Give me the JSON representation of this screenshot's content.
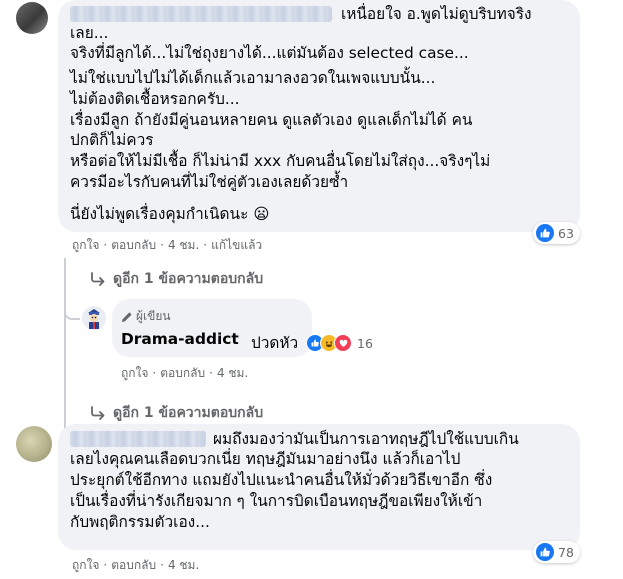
{
  "comments": [
    {
      "commenter_name": "",
      "lines": [
        "เหนื่อยใจ อ.พูดไม่ดูบริบทจริง",
        "เลย...",
        "จริงที่มีลูกได้...ไม่ใช่ถุงยางได้...แต่มันต้อง selected case...",
        "ไม่ใช่แบบไปไม่ได้เด็กแล้วเอามาลงอวดในเพจแบบนั้น...",
        "ไม่ต้องติดเชื้อหรอกครับ...",
        "เรื่องมีลูก ถ้ายังมีคู่นอนหลายคน ดูแลตัวเอง ดูแลเด็กไม่ได้ คน",
        "ปกติก็ไม่ควร",
        "หรือต่อให้ไม่มีเชื้อ ก็ไม่น่ามี xxx กับคนอื่นโดยไม่ใส่ถุง...จริงๆไม่",
        "ควรมีอะไรกับคนที่ไม่ใช่คู่ตัวเองเลยด้วยซ้ำ",
        "",
        "นี่ยังไม่พูดเรื่องคุมกำเนิดนะ 😦"
      ],
      "actions": {
        "like": "ถูกใจ",
        "reply": "ตอบกลับ",
        "time": "4 ชม.",
        "edited": "แก้ไขแล้ว"
      },
      "reaction_count": "63",
      "view_replies": "ดูอีก 1 ข้อความตอบกลับ"
    },
    {
      "commenter_name": "",
      "lines": [
        "ผมถึงมองว่ามันเป็นการเอาทฤษฎีไปใช้แบบเกิน",
        "เลยไงคุณคนเลือดบวกเนี่ย ทฤษฎีมันมาอย่างนึง แล้วก็เอาไป",
        "ประยุกต์ใช้อีกทาง แถมยังไปแนะนำคนอื่นให้มั่วด้วยวิธีเขาอีก ซึ่ง",
        "เป็นเรื่องที่น่ารังเกียจมาก ๆ ในการบิดเบือนทฤษฎีขอเพียงให้เข้า",
        "กับพฤติกรรมตัวเอง..."
      ],
      "actions": {
        "like": "ถูกใจ",
        "reply": "ตอบกลับ",
        "time": "4 ชม."
      },
      "reaction_count": "78"
    }
  ],
  "reply": {
    "badge": "ผู้เขียน",
    "name": "Drama-addict",
    "text": "ปวดหัว",
    "reaction_count": "16",
    "actions": {
      "like": "ถูกใจ",
      "reply": "ตอบกลับ",
      "time": "4 ชม."
    },
    "view_replies": "ดูอีก 1 ข้อความตอบกลับ"
  },
  "colors": {
    "bubble": "#f0f2f5",
    "meta_text": "#65676b",
    "like_blue": "#1877f2",
    "haha_yellow": "#f7b928",
    "love_red": "#f33e58",
    "thread_line": "#ccd0d5"
  },
  "icons": [
    "like-icon",
    "haha-icon",
    "love-icon",
    "pencil-icon",
    "reply-arrow-icon"
  ]
}
